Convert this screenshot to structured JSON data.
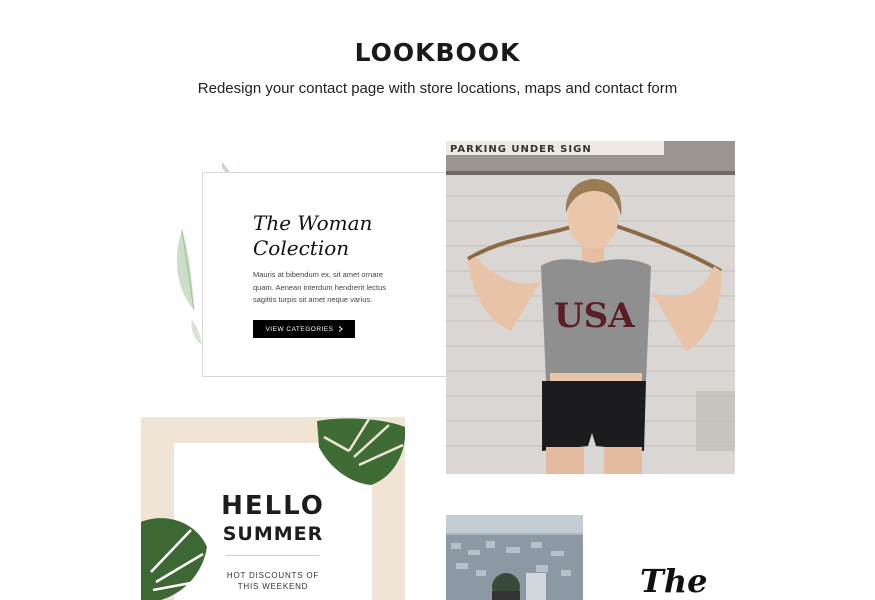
{
  "header": {
    "title": "LOOKBOOK",
    "subtitle": "Redesign your contact page with store locations, maps and contact form"
  },
  "card": {
    "heading_line1": "The Woman",
    "heading_line2": "Colection",
    "text_line1": "Mauris at bibendum ex, sit amet ornare",
    "text_line2": "quam. Aenean interdum hendrerit lectus",
    "text_line3": "sagittis turpis sit amet neque varius.",
    "button_label": "VIEW CATEGORIES",
    "button_icon": "chevron-right-icon"
  },
  "photo_main": {
    "sign_text": "PARKING UNDER SIGN",
    "shirt_text": "USA"
  },
  "poster": {
    "hello": "HELLO",
    "summer": "SUMMER",
    "promo_line1": "HOT DISCOUNTS OF",
    "promo_line2": "THIS WEEKEND"
  },
  "teaser": {
    "text": "The"
  },
  "colors": {
    "accent": "#000000",
    "poster_frame": "#f0e4d4",
    "leaf_green": "#2f5a2a"
  }
}
